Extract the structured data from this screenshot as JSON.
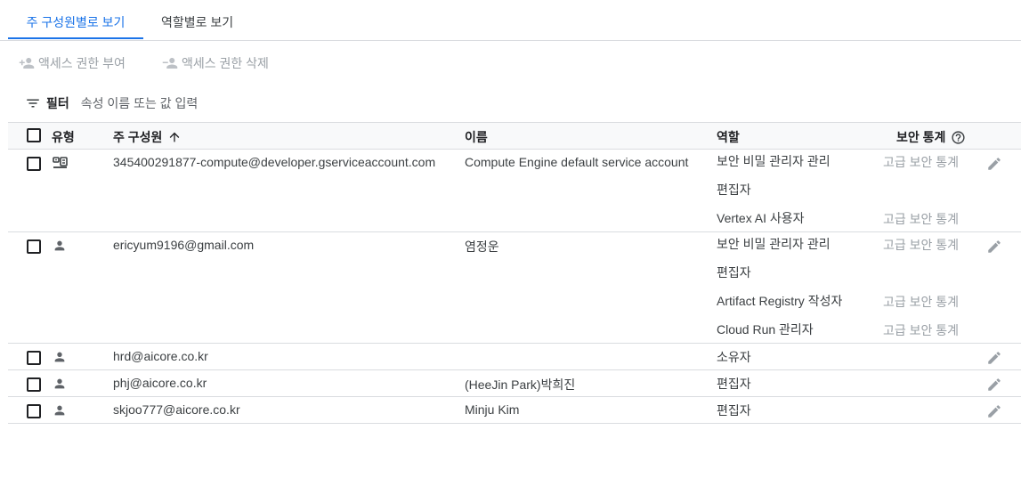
{
  "tabs": {
    "by_principal": "주 구성원별로 보기",
    "by_role": "역할별로 보기"
  },
  "actions": {
    "grant": "액세스 권한 부여",
    "revoke": "액세스 권한 삭제"
  },
  "filter": {
    "label": "필터",
    "placeholder": "속성 이름 또는 값 입력"
  },
  "table": {
    "headers": {
      "type": "유형",
      "principal": "주 구성원",
      "name": "이름",
      "role": "역할",
      "security_insights": "보안 통계"
    },
    "rows": [
      {
        "type_icon": "service-account-icon",
        "principal": "345400291877-compute@developer.gserviceaccount.com",
        "name": "Compute Engine default service account",
        "roles": [
          {
            "role": "보안 비밀 관리자 관리",
            "stat": "고급 보안 통계"
          },
          {
            "role": "편집자",
            "stat": ""
          },
          {
            "role": "Vertex AI 사용자",
            "stat": "고급 보안 통계"
          }
        ]
      },
      {
        "type_icon": "person-icon",
        "principal": "ericyum9196@gmail.com",
        "name": "염정운",
        "roles": [
          {
            "role": "보안 비밀 관리자 관리",
            "stat": "고급 보안 통계"
          },
          {
            "role": "편집자",
            "stat": ""
          },
          {
            "role": "Artifact Registry 작성자",
            "stat": "고급 보안 통계"
          },
          {
            "role": "Cloud Run 관리자",
            "stat": "고급 보안 통계"
          }
        ]
      },
      {
        "type_icon": "person-icon",
        "principal": "hrd@aicore.co.kr",
        "name": "",
        "roles": [
          {
            "role": "소유자",
            "stat": ""
          }
        ]
      },
      {
        "type_icon": "person-icon",
        "principal": "phj@aicore.co.kr",
        "name": "(HeeJin Park)박희진",
        "roles": [
          {
            "role": "편집자",
            "stat": ""
          }
        ]
      },
      {
        "type_icon": "person-icon",
        "principal": "skjoo777@aicore.co.kr",
        "name": "Minju Kim",
        "roles": [
          {
            "role": "편집자",
            "stat": ""
          }
        ]
      }
    ]
  }
}
